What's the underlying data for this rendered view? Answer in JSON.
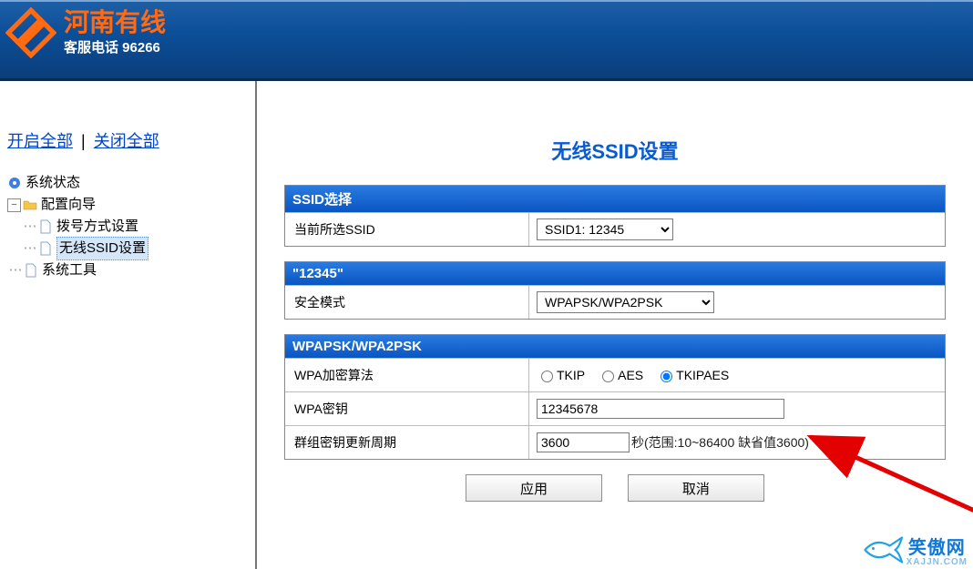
{
  "header": {
    "brand": "河南有线",
    "hotline": "客服电话  96266"
  },
  "sidebar": {
    "expand_all": "开启全部",
    "collapse_all": "关闭全部",
    "items": {
      "status": "系统状态",
      "wizard": "配置向导",
      "dial": "拨号方式设置",
      "ssid": "无线SSID设置",
      "tools": "系统工具"
    }
  },
  "main": {
    "title": "无线SSID设置",
    "panel_ssid": {
      "header": "SSID选择",
      "label_current": "当前所选SSID",
      "selected": "SSID1: 12345"
    },
    "panel_sec": {
      "header": "\"12345\"",
      "label_mode": "安全模式",
      "selected": "WPAPSK/WPA2PSK"
    },
    "panel_wpa": {
      "header": "WPAPSK/WPA2PSK",
      "label_algo": "WPA加密算法",
      "opt_tkip": "TKIP",
      "opt_aes": "AES",
      "opt_tkipaes": "TKIPAES",
      "label_key": "WPA密钥",
      "key_value": "12345678",
      "label_period": "群组密钥更新周期",
      "period_value": "3600",
      "period_hint": "秒(范围:10~86400 缺省值3600)"
    },
    "buttons": {
      "apply": "应用",
      "cancel": "取消"
    }
  },
  "watermark": {
    "cn": "笑傲网",
    "url": "XAJJN.COM"
  }
}
